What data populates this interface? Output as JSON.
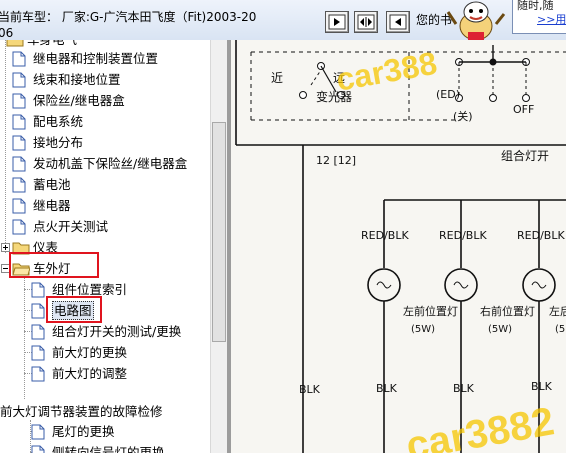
{
  "titlebar": {
    "car_title": "当前车型：  厂家:G-广汽本田飞度（Fit)2003-2006",
    "hint_text": "您的书",
    "promo_line1": "随时,随",
    "promo_line2": ">>用"
  },
  "tree": {
    "items": [
      {
        "label": "车身电气"
      },
      {
        "label": "继电器和控制装置位置"
      },
      {
        "label": "线束和接地位置"
      },
      {
        "label": "保险丝/继电器盒"
      },
      {
        "label": "配电系统"
      },
      {
        "label": "接地分布"
      },
      {
        "label": "发动机盖下保险丝/继电器盒"
      },
      {
        "label": "蓄电池"
      },
      {
        "label": "继电器"
      },
      {
        "label": "点火开关测试"
      },
      {
        "label": "仪表"
      },
      {
        "label": "车外灯"
      },
      {
        "label": "组件位置索引"
      },
      {
        "label": "电路图"
      },
      {
        "label": "组合灯开关的测试/更换"
      },
      {
        "label": "前大灯的更换"
      },
      {
        "label": "前大灯的调整"
      },
      {
        "label": "前大灯调节器装置的故障检修"
      },
      {
        "label": "尾灯的更换"
      },
      {
        "label": "侧转向信号灯的更换"
      }
    ]
  },
  "diagram": {
    "labels": {
      "near_left": "近",
      "far": "远",
      "dimmer": "变光器",
      "ed": "(ED)",
      "off": "OFF",
      "bracket": "(关)",
      "wire12": "12  [12]",
      "combo": "组合灯开",
      "red_blk_1": "RED/BLK",
      "red_blk_2": "RED/BLK",
      "red_blk_3": "RED/BLK",
      "lamp1_line1": "左前位置灯",
      "lamp1_line2": "(5W)",
      "lamp2_line1": "右前位置灯",
      "lamp2_line2": "(5W)",
      "lamp3_line1": "左后",
      "lamp3_line2": "(5",
      "blk_0": "BLK",
      "blk_1": "BLK",
      "blk_2": "BLK",
      "blk_3": "BLK",
      "watermark_top": "car388",
      "watermark_bottom": "car3882"
    }
  },
  "colors": {
    "highlight_box": "#e0141e",
    "watermark": "#f5c600",
    "promo_link": "#1a3fd0",
    "selection": "#dfe6f3"
  }
}
